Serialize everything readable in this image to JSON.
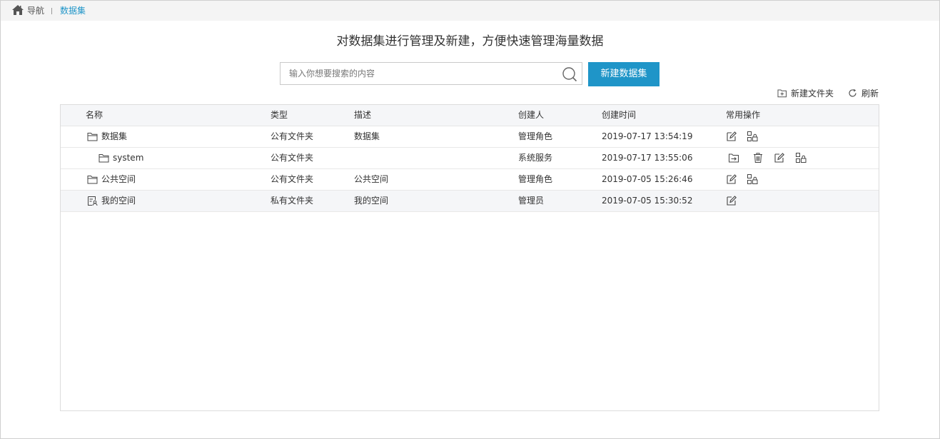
{
  "breadcrumb": {
    "home": "导航",
    "current": "数据集"
  },
  "subtitle": "对数据集进行管理及新建，方便快速管理海量数据",
  "search": {
    "placeholder": "输入你想要搜索的内容",
    "value": ""
  },
  "new_dataset_button": "新建数据集",
  "toolbar": {
    "new_folder": "新建文件夹",
    "refresh": "刷新"
  },
  "table": {
    "columns": [
      "名称",
      "类型",
      "描述",
      "创建人",
      "创建时间",
      "常用操作"
    ],
    "rows": [
      {
        "name": "数据集",
        "icon": "folder-icon",
        "type": "公有文件夹",
        "desc": "数据集",
        "creator": "管理角色",
        "time": "2019-07-17 13:54:19",
        "ops": [
          "edit-icon",
          "permission-icon"
        ]
      },
      {
        "name": "system",
        "icon": "folder-icon",
        "type": "公有文件夹",
        "desc": "",
        "creator": "系统服务",
        "time": "2019-07-17 13:55:06",
        "ops": [
          "move-icon",
          "delete-icon",
          "edit-icon",
          "permission-icon"
        ]
      },
      {
        "name": "公共空间",
        "icon": "folder-icon",
        "type": "公有文件夹",
        "desc": "公共空间",
        "creator": "管理角色",
        "time": "2019-07-05 15:26:46",
        "ops": [
          "edit-icon",
          "permission-icon"
        ]
      },
      {
        "name": "我的空间",
        "icon": "user-space-icon",
        "type": "私有文件夹",
        "desc": "我的空间",
        "creator": "管理员",
        "time": "2019-07-05 15:30:52",
        "ops": [
          "edit-icon"
        ]
      }
    ]
  },
  "colors": {
    "accent": "#1f95c8",
    "header_bg": "#f5f6f8",
    "topbar_bg": "#f4f4f4"
  }
}
